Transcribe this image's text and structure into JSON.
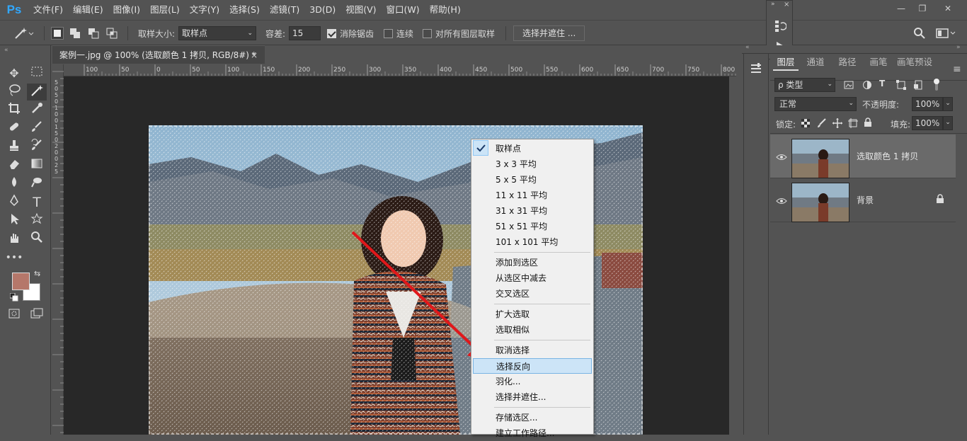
{
  "app": {
    "logo": "Ps",
    "brand_color": "#31a8ff"
  },
  "menubar": {
    "items": [
      "文件(F)",
      "编辑(E)",
      "图像(I)",
      "图层(L)",
      "文字(Y)",
      "选择(S)",
      "滤镜(T)",
      "3D(D)",
      "视图(V)",
      "窗口(W)",
      "帮助(H)"
    ]
  },
  "window_controls": {
    "minimize": "—",
    "restore": "❐",
    "close": "✕"
  },
  "options": {
    "sample_size_label": "取样大小:",
    "sample_size_value": "取样点",
    "tolerance_label": "容差:",
    "tolerance_value": "15",
    "antialias_label": "消除锯齿",
    "antialias_checked": true,
    "contiguous_label": "连续",
    "contiguous_checked": false,
    "all_layers_label": "对所有图层取样",
    "all_layers_checked": false,
    "select_mask_button": "选择并遮住 ..."
  },
  "document": {
    "tab_title": "案例一.jpg @ 100% (选取颜色 1 拷贝, RGB/8#) *",
    "close": "×"
  },
  "ruler": {
    "top_ticks": [
      "100",
      "50",
      "0",
      "50",
      "100",
      "150",
      "200",
      "250",
      "300",
      "350",
      "400",
      "450",
      "500",
      "550",
      "600",
      "650",
      "700",
      "750",
      "800"
    ],
    "left_ticks": [
      "5",
      "0",
      "5",
      "0",
      "1",
      "0",
      "0",
      "1",
      "5",
      "0",
      "2",
      "0",
      "0",
      "2",
      "5"
    ]
  },
  "context_menu": {
    "groups": [
      [
        {
          "label": "取样点",
          "checked": true
        },
        {
          "label": "3 x 3 平均"
        },
        {
          "label": "5 x 5 平均"
        },
        {
          "label": "11 x 11 平均"
        },
        {
          "label": "31 x 31 平均"
        },
        {
          "label": "51 x 51 平均"
        },
        {
          "label": "101 x 101 平均"
        }
      ],
      [
        {
          "label": "添加到选区"
        },
        {
          "label": "从选区中减去"
        },
        {
          "label": "交叉选区"
        }
      ],
      [
        {
          "label": "扩大选取"
        },
        {
          "label": "选取相似"
        }
      ],
      [
        {
          "label": "取消选择"
        },
        {
          "label": "选择反向",
          "highlighted": true
        },
        {
          "label": "羽化..."
        },
        {
          "label": "选择并遮住..."
        }
      ],
      [
        {
          "label": "存储选区..."
        },
        {
          "label": "建立工作路径..."
        }
      ]
    ]
  },
  "annotation": {
    "arrow_color": "#e0181b"
  },
  "panel": {
    "tabs": [
      "图层",
      "通道",
      "路径",
      "画笔",
      "画笔预设"
    ],
    "active_tab": "图层",
    "filter_label": "ρ 类型",
    "blend_mode": "正常",
    "opacity_label": "不透明度:",
    "opacity_value": "100%",
    "lock_label": "锁定:",
    "fill_label": "填充:",
    "fill_value": "100%",
    "layers": [
      {
        "name": "选取颜色 1 拷贝",
        "selected": true,
        "locked": false
      },
      {
        "name": "背景",
        "selected": false,
        "locked": true
      }
    ]
  },
  "colors": {
    "foreground": "#b5776a",
    "background": "#ffffff"
  }
}
